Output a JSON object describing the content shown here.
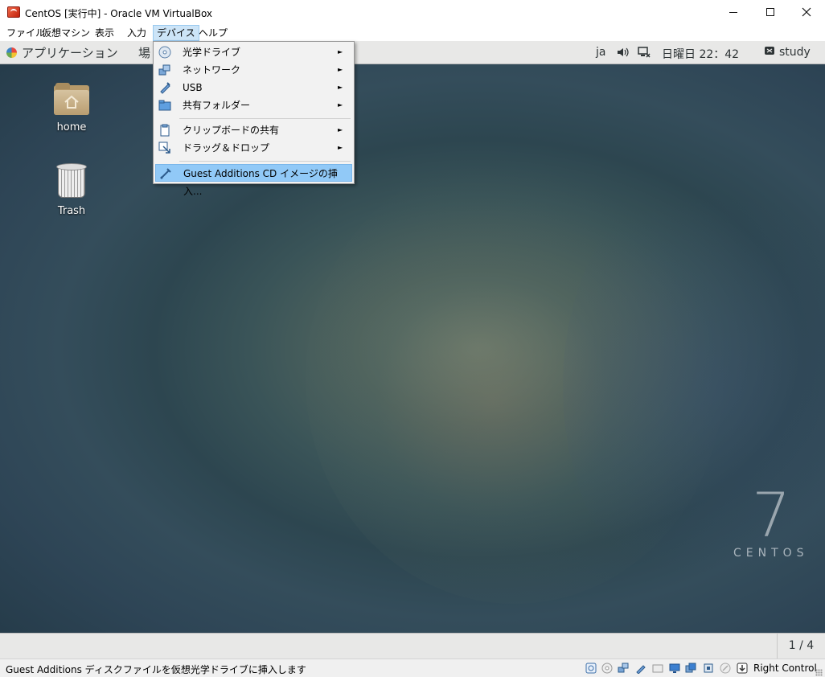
{
  "window": {
    "title": "CentOS [実行中] - Oracle VM VirtualBox",
    "minimize_icon": "minimize-icon",
    "maximize_icon": "maximize-icon",
    "close_icon": "close-icon"
  },
  "menubar": {
    "items": [
      {
        "label": "ファイル"
      },
      {
        "label": "仮想マシン"
      },
      {
        "label": "表示"
      },
      {
        "label": "入力"
      },
      {
        "label": "デバイス"
      },
      {
        "label": "ヘルプ"
      }
    ],
    "active_index": 4
  },
  "gnome_topbar": {
    "applications": "アプリケーション",
    "places": "場",
    "language": "ja",
    "clock": "日曜日 22：42",
    "user": "study",
    "icons": [
      "volume-icon",
      "network-icon",
      "user-icon"
    ]
  },
  "desktop": {
    "icons": [
      {
        "label": "home",
        "icon": "home-folder-icon"
      },
      {
        "label": "Trash",
        "icon": "trash-icon"
      }
    ],
    "brand_number": "7",
    "brand_word": "CENTOS"
  },
  "devices_menu": {
    "items": [
      {
        "label": "光学ドライブ",
        "icon": "optical-drive-icon",
        "submenu": true
      },
      {
        "label": "ネットワーク",
        "icon": "network-adapter-icon",
        "submenu": true
      },
      {
        "label": "USB",
        "icon": "usb-icon",
        "submenu": true
      },
      {
        "label": "共有フォルダー",
        "icon": "shared-folder-icon",
        "submenu": true
      },
      {
        "label": "クリップボードの共有",
        "icon": "clipboard-icon",
        "submenu": true
      },
      {
        "label": "ドラッグ＆ドロップ",
        "icon": "drag-drop-icon",
        "submenu": true
      },
      {
        "label": "Guest Additions CD イメージの挿入...",
        "icon": "guest-additions-icon",
        "submenu": false,
        "highlighted": true
      }
    ],
    "submenu_arrow": "►"
  },
  "gnome_bottombar": {
    "workspace": "1 / 4"
  },
  "statusbar": {
    "message": "Guest Additions ディスクファイルを仮想光学ドライブに挿入します",
    "host_key": "Right Control",
    "icons": [
      "hard-disk-icon",
      "optical-disk-icon",
      "network-icon",
      "usb-icon",
      "shared-folders-icon",
      "display-icon",
      "recording-icon",
      "cpu-icon",
      "mouse-integration-icon",
      "host-key-icon"
    ]
  }
}
